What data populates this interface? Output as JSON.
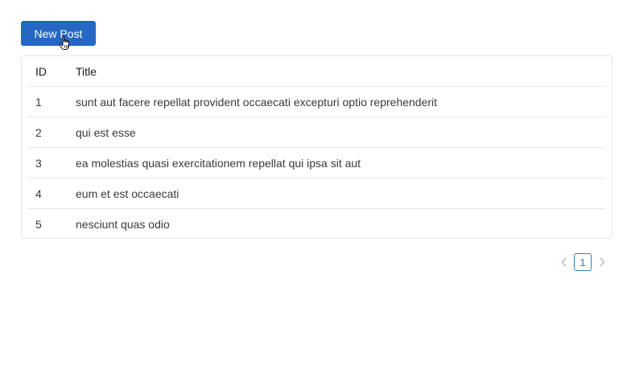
{
  "toolbar": {
    "new_post_label": "New Post"
  },
  "table": {
    "columns": [
      "ID",
      "Title"
    ],
    "rows": [
      {
        "id": "1",
        "title": "sunt aut facere repellat provident occaecati excepturi optio reprehenderit"
      },
      {
        "id": "2",
        "title": "qui est esse"
      },
      {
        "id": "3",
        "title": "ea molestias quasi exercitationem repellat qui ipsa sit aut"
      },
      {
        "id": "4",
        "title": "eum et est occaecati"
      },
      {
        "id": "5",
        "title": "nesciunt quas odio"
      }
    ]
  },
  "pagination": {
    "prev_icon": "chevron-left-icon",
    "current_page": "1",
    "next_icon": "chevron-right-icon"
  },
  "colors": {
    "primary": "#2568c4",
    "pagination_active": "#2d7fc9",
    "border": "#e2e4e8"
  }
}
